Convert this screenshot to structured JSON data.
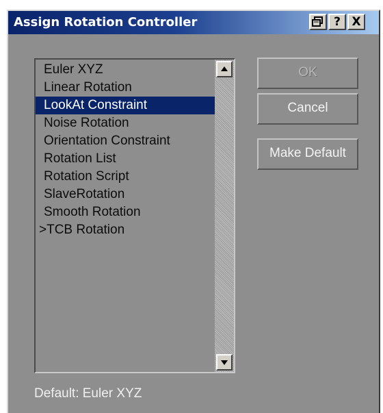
{
  "window": {
    "title": "Assign Rotation Controller"
  },
  "titlebar_buttons": {
    "minimize_icon": "restore-icon",
    "help_label": "?",
    "close_label": "X"
  },
  "controllers": {
    "items": [
      {
        "label": "Euler XYZ"
      },
      {
        "label": "Linear Rotation"
      },
      {
        "label": "LookAt Constraint",
        "selected": true
      },
      {
        "label": "Noise Rotation"
      },
      {
        "label": "Orientation Constraint"
      },
      {
        "label": "Rotation List"
      },
      {
        "label": "Rotation Script"
      },
      {
        "label": "SlaveRotation"
      },
      {
        "label": "Smooth Rotation"
      },
      {
        "label": ">TCB Rotation",
        "current": true
      }
    ]
  },
  "buttons": {
    "ok_label": "OK",
    "cancel_label": "Cancel",
    "make_default_label": "Make Default"
  },
  "footer": {
    "default_text": "Default:  Euler XYZ"
  },
  "colors": {
    "selection": "#0a246a",
    "panel": "#8e8e8e",
    "title_start": "#0a246a",
    "title_end": "#a6caf0"
  }
}
